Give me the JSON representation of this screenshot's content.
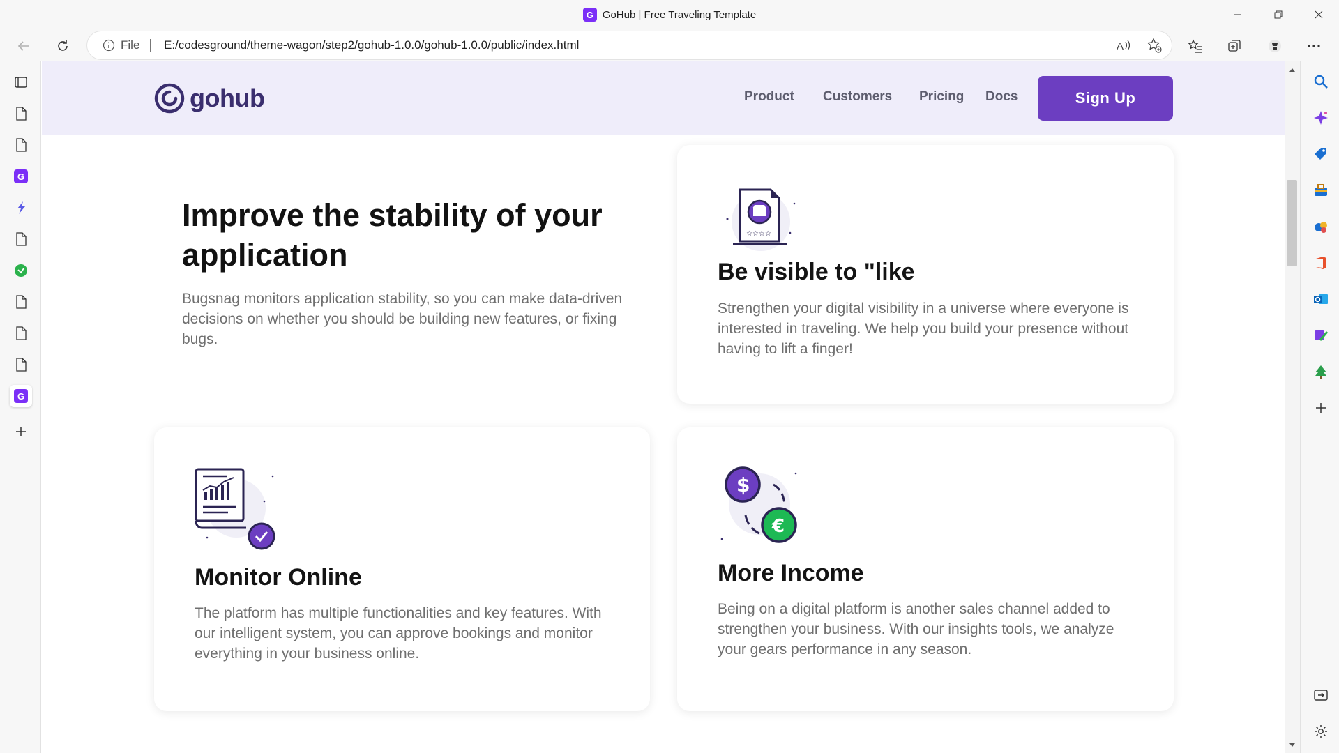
{
  "browser": {
    "tab_title": "GoHub | Free Traveling Template",
    "favicon_letter": "G",
    "address": {
      "scheme_label": "File",
      "url": "E:/codesground/theme-wagon/step2/gohub-1.0.0/gohub-1.0.0/public/index.html"
    }
  },
  "site": {
    "logo_text": "gohub",
    "nav": {
      "product": "Product",
      "customers": "Customers",
      "pricing": "Pricing",
      "docs": "Docs",
      "signup": "Sign Up"
    },
    "intro": {
      "title": "Improve the stability of your application",
      "body": "Bugsnag monitors application stability, so you can make data-driven decisions on whether you should be building new features, or fixing bugs."
    },
    "cards": [
      {
        "title": "Be visible to \"like",
        "body": "Strengthen your digital visibility in a universe where everyone is interested in traveling. We help you build your presence without having to lift a finger!",
        "icon": "storefront-document-icon"
      },
      {
        "title": "Monitor Online",
        "body": "The platform has multiple functionalities and key features. With our intelligent system, you can approve bookings and monitor everything in your business online.",
        "icon": "report-chart-icon"
      },
      {
        "title": "More Income",
        "body": "Being on a digital platform is another sales channel added to strengthen your business. With our insights tools, we analyze your gears performance in any season.",
        "icon": "currency-exchange-icon"
      }
    ]
  },
  "colors": {
    "brand_purple": "#6c3ec1",
    "header_bg": "#efedfa",
    "money_green": "#1db954"
  }
}
